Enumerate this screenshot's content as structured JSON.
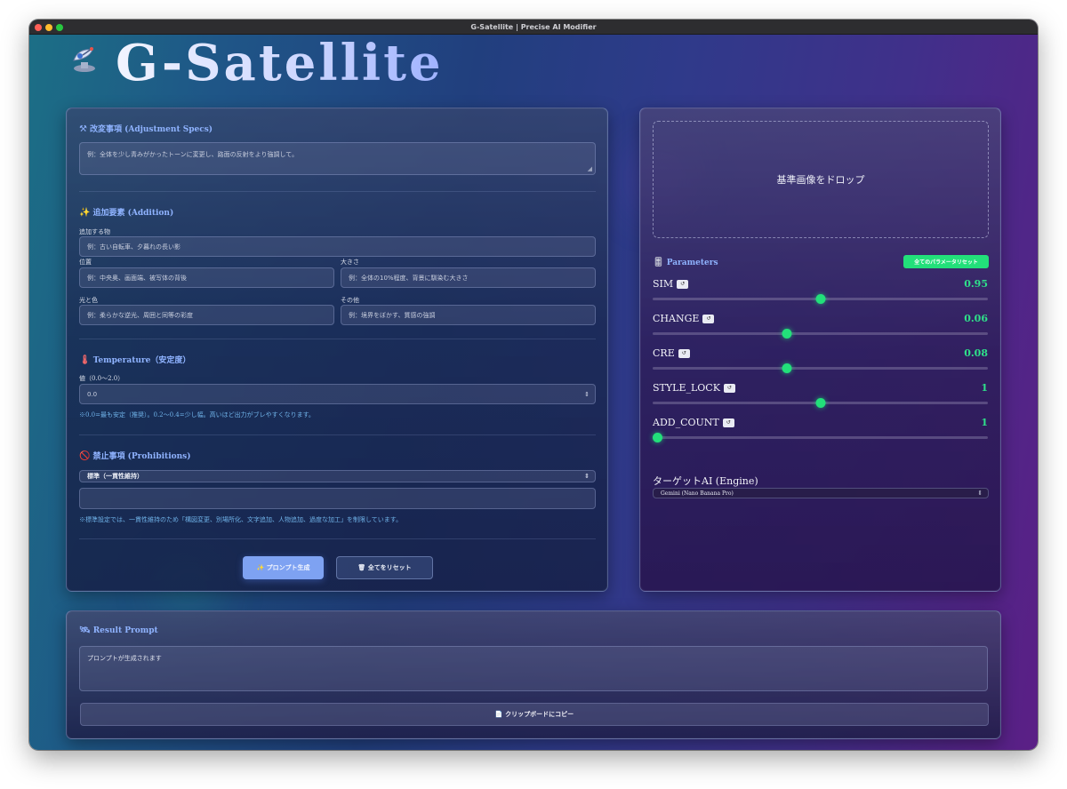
{
  "window": {
    "title": "G-Satellite | Precise AI Modifier"
  },
  "app": {
    "title": "G-Satellite",
    "logo_icon": "satellite-dish-icon"
  },
  "adjustment": {
    "title": "改変事項 (Adjustment Specs)",
    "icon": "hammer-wrench-icon",
    "placeholder": "例：全体を少し青みがかったトーンに変更し、路面の反射をより強調して。"
  },
  "addition": {
    "title": "追加要素 (Addition)",
    "icon": "sparkles-icon",
    "object_label": "追加する物",
    "object_placeholder": "例：古い自転車、夕暮れの長い影",
    "position_label": "位置",
    "position_placeholder": "例：中央奥、画面端、被写体の背後",
    "size_label": "大きさ",
    "size_placeholder": "例：全体の10%程度、背景に馴染む大きさ",
    "light_label": "光と色",
    "light_placeholder": "例：柔らかな逆光、周囲と同等の彩度",
    "other_label": "その他",
    "other_placeholder": "例：境界をぼかす、質感の強調"
  },
  "temperature": {
    "title": "Temperature（安定度）",
    "icon": "thermometer-icon",
    "value_label": "値（0.0〜2.0）",
    "value": "0.0",
    "note": "※0.0=最も安定（推奨）。0.2〜0.4=少し幅。高いほど出力がブレやすくなります。"
  },
  "prohibitions": {
    "title": "禁止事項 (Prohibitions)",
    "icon": "prohibited-icon",
    "selected": "標準（一貫性維持）",
    "extra_value": "",
    "note": "※標準設定では、一貫性維持のため「構図変更、別場所化、文字追加、人物追加、過度な加工」を制限しています。"
  },
  "actions": {
    "generate_label": "✨ プロンプト生成",
    "reset_all_label": "🗑 全てをリセット"
  },
  "image": {
    "drop_label": "基準画像をドロップ"
  },
  "parameters": {
    "title": "Parameters",
    "icon": "sliders-icon",
    "reset_label": "全てのパラメータリセット",
    "reset_mini_label": "↺",
    "items": [
      {
        "name": "SIM",
        "value": "0.95",
        "level": 0.5
      },
      {
        "name": "CHANGE",
        "value": "0.06",
        "level": 0.4
      },
      {
        "name": "CRE",
        "value": "0.08",
        "level": 0.4
      },
      {
        "name": "STYLE_LOCK",
        "value": "1",
        "level": 0.5
      },
      {
        "name": "ADD_COUNT",
        "value": "1",
        "level": 0.0
      }
    ]
  },
  "engine": {
    "title": "ターゲットAI (Engine)",
    "selected": "Gemini (Nano Banana Pro)"
  },
  "result": {
    "title": "Result Prompt",
    "icon": "satellite-icon",
    "placeholder": "プロンプトが生成されます",
    "copy_label": "📄 クリップボードにコピー"
  },
  "colors": {
    "accent_green": "#22e07a",
    "accent_blue": "#7ea2f2",
    "section_title": "#8fb3ff"
  }
}
